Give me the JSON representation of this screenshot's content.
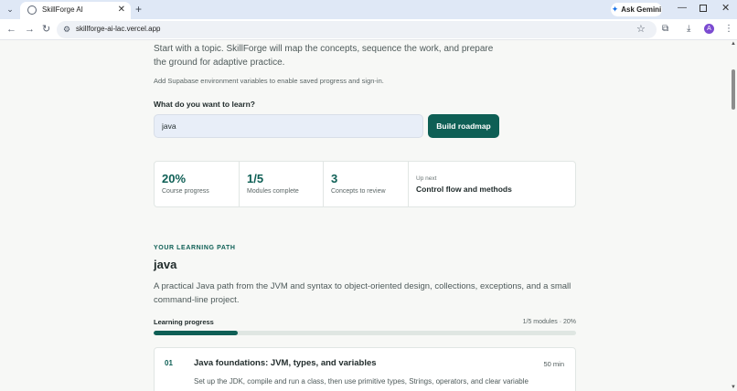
{
  "browser": {
    "tab_title": "SkillForge AI",
    "url": "skillforge-ai-lac.vercel.app",
    "gemini_label": "Ask Gemini",
    "avatar_initial": "A"
  },
  "hero": {
    "intro": "Start with a topic. SkillForge will map the concepts, sequence the work, and prepare the ground for adaptive practice.",
    "notice": "Add Supabase environment variables to enable saved progress and sign-in.",
    "question": "What do you want to learn?",
    "input_value": "java",
    "button_label": "Build roadmap"
  },
  "stats": {
    "progress_value": "20%",
    "progress_label": "Course progress",
    "modules_value": "1/5",
    "modules_label": "Modules complete",
    "review_value": "3",
    "review_label": "Concepts to review",
    "next_label": "Up next",
    "next_value": "Control flow and methods"
  },
  "path": {
    "eyebrow": "YOUR LEARNING PATH",
    "title": "java",
    "description": "A practical Java path from the JVM and syntax to object-oriented design, collections, exceptions, and a small command-line project.",
    "progress_label": "Learning progress",
    "progress_meta": "1/5 modules · 20%",
    "progress_fraction": 0.2
  },
  "modules": [
    {
      "number": "01",
      "title": "Java foundations: JVM, types, and variables",
      "duration": "50 min",
      "description": "Set up the JDK, compile and run a class, then use primitive types, Strings, operators, and clear variable"
    }
  ],
  "colors": {
    "accent": "#0e5f55",
    "tabstrip": "#dfe8f6"
  }
}
